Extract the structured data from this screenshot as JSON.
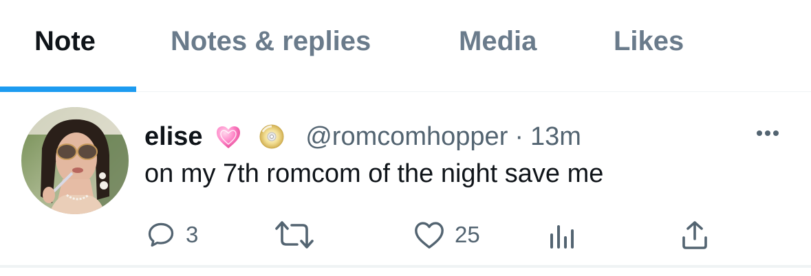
{
  "tabs": [
    {
      "label": "Note",
      "active": true
    },
    {
      "label": "Notes & replies",
      "active": false
    },
    {
      "label": "Media",
      "active": false
    },
    {
      "label": "Likes",
      "active": false
    }
  ],
  "tweet": {
    "display_name": "elise",
    "name_emojis": [
      "pink-heart-emoji",
      "dvd-disc-emoji"
    ],
    "handle": "@romcomhopper",
    "separator": "·",
    "time": "13m",
    "text": "on my 7th romcom of the night save me",
    "actions": {
      "reply": {
        "icon": "reply-icon",
        "count": "3"
      },
      "retweet": {
        "icon": "retweet-icon",
        "count": ""
      },
      "like": {
        "icon": "heart-icon",
        "count": "25"
      },
      "analytics": {
        "icon": "analytics-icon",
        "count": ""
      },
      "share": {
        "icon": "share-icon",
        "count": ""
      }
    },
    "more_icon": "more-dots-icon"
  },
  "colors": {
    "accent": "#1d9bf0",
    "primary_text": "#0f1419",
    "secondary_text": "#536471",
    "inactive_tab": "#6a7b8b",
    "divider": "#eff3f4"
  }
}
